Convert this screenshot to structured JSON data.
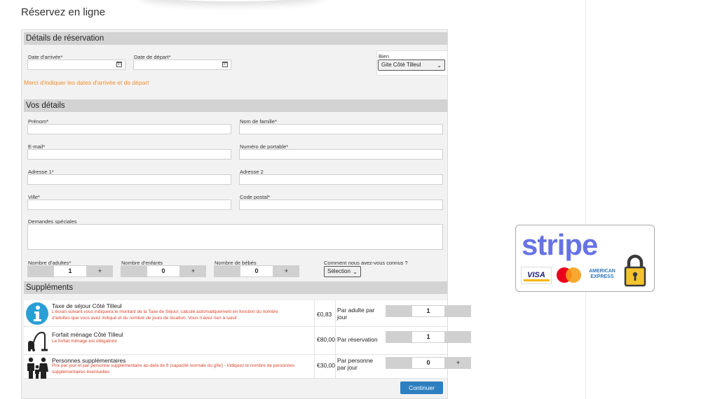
{
  "page": {
    "title": "Réservez en ligne"
  },
  "reservation": {
    "section_title": "Détails de réservation",
    "arrival_label": "Date d'arrivée*",
    "departure_label": "Date de départ*",
    "property_label": "Bien",
    "property_value": "Gite Côté Tilleul",
    "warning": "Merci d'indiquer les dates d'arrivée et de départ"
  },
  "details": {
    "section_title": "Vos détails",
    "firstname_label": "Prénom*",
    "lastname_label": "Nom de famille*",
    "email_label": "E-mail*",
    "mobile_label": "Numéro de portable*",
    "address1_label": "Adresse 1*",
    "address2_label": "Adresse 2",
    "city_label": "Ville*",
    "postcode_label": "Code postal*",
    "requests_label": "Demandes spéciales",
    "adults_label": "Nombre d'adultes*",
    "adults_value": "1",
    "children_label": "Nombre d'enfants",
    "children_value": "0",
    "babies_label": "Nombre de bébés",
    "babies_value": "0",
    "source_label": "Comment nous avez-vous connus ?",
    "source_value": "Sélection",
    "plus": "+"
  },
  "supplements": {
    "section_title": "Suppléments",
    "items": [
      {
        "title": "Taxe de séjour Côté Tilleul",
        "desc": "L'écran suivant vous indiquera le montant de la Taxe de Séjour, calculé automatiquement en fonction du nombre d'adultes que vous avez indiqué et du nombre de jours de location. Vous n'avez rien à saisir",
        "price": "€0,83",
        "unit": "Par adulte par jour",
        "qty": "1",
        "icon": "info-icon"
      },
      {
        "title": "Forfait ménage Côté Tilleul",
        "desc": "Le forfait ménage est obligatoire",
        "price": "€80,00",
        "unit": "Par réservation",
        "qty": "1",
        "icon": "vacuum-cleaner-icon"
      },
      {
        "title": "Personnes supplémentaires",
        "desc": "Prix par jour et par personne supplémentaire au-delà de 6 (capacité normale du gîte) - Indiquez le nombre de personnes supplémentaires éventuelles",
        "price": "€30,00",
        "unit": "Par personne par jour",
        "qty": "0",
        "plus": "+",
        "icon": "family-icon"
      }
    ]
  },
  "continue_label": "Continuer",
  "badge": {
    "brand": "stripe",
    "visa": "VISA",
    "amex_line1": "AMERICAN",
    "amex_line2": "EXPRESS"
  },
  "colors": {
    "accent": "#2e7fc0",
    "warning": "#ef8d2c",
    "stripe": "#6772e5",
    "error_text": "#d9432b"
  }
}
